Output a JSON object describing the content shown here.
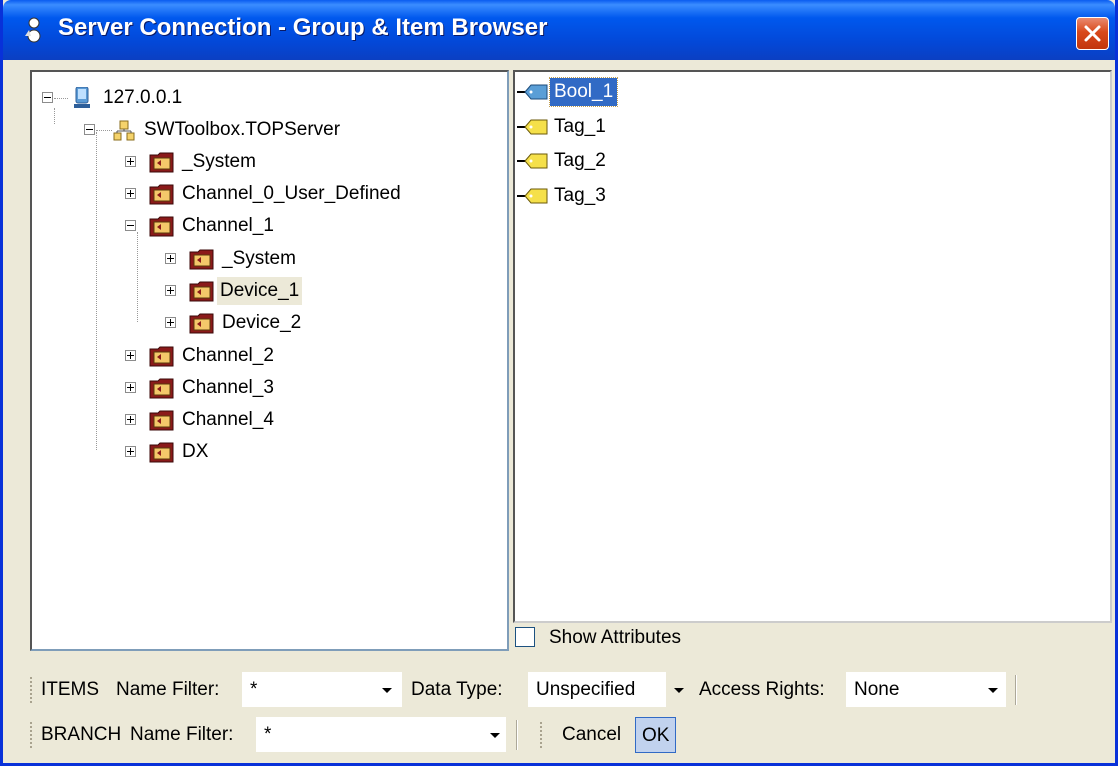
{
  "window": {
    "title": "Server Connection - Group & Item Browser"
  },
  "tree": [
    {
      "label": "127.0.0.1",
      "icon": "computer-icon",
      "expander": "minus"
    },
    {
      "label": "SWToolbox.TOPServer",
      "icon": "server-icon",
      "expander": "minus"
    },
    {
      "label": "_System",
      "icon": "folder-icon",
      "expander": "plus"
    },
    {
      "label": "Channel_0_User_Defined",
      "icon": "folder-icon",
      "expander": "plus"
    },
    {
      "label": "Channel_1",
      "icon": "folder-icon",
      "expander": "minus"
    },
    {
      "label": "_System",
      "icon": "folder-icon",
      "expander": "plus"
    },
    {
      "label": "Device_1",
      "icon": "folder-icon",
      "expander": "plus",
      "selected": true
    },
    {
      "label": "Device_2",
      "icon": "folder-icon",
      "expander": "plus"
    },
    {
      "label": "Channel_2",
      "icon": "folder-icon",
      "expander": "plus"
    },
    {
      "label": "Channel_3",
      "icon": "folder-icon",
      "expander": "plus"
    },
    {
      "label": "Channel_4",
      "icon": "folder-icon",
      "expander": "plus"
    },
    {
      "label": "DX",
      "icon": "folder-icon",
      "expander": "plus"
    }
  ],
  "items": [
    {
      "label": "Bool_1",
      "icon": "tag-icon",
      "selected": true
    },
    {
      "label": "Tag_1",
      "icon": "tag-icon"
    },
    {
      "label": "Tag_2",
      "icon": "tag-icon"
    },
    {
      "label": "Tag_3",
      "icon": "tag-icon"
    }
  ],
  "show_attributes": {
    "label": "Show Attributes",
    "checked": false
  },
  "items_toolbar": {
    "prefix": "ITEMS",
    "name_filter_label": "Name Filter:",
    "name_filter_value": "*",
    "data_type_label": "Data Type:",
    "data_type_value": "Unspecified",
    "access_rights_label": "Access Rights:",
    "access_rights_value": "None"
  },
  "branch_toolbar": {
    "prefix": "BRANCH",
    "name_filter_label": "Name Filter:",
    "name_filter_value": "*",
    "cancel_label": "Cancel",
    "ok_label": "OK"
  },
  "colors": {
    "selection": "#316ac5",
    "title_bar": "#0058ee",
    "folder": "#8b1a1a"
  }
}
